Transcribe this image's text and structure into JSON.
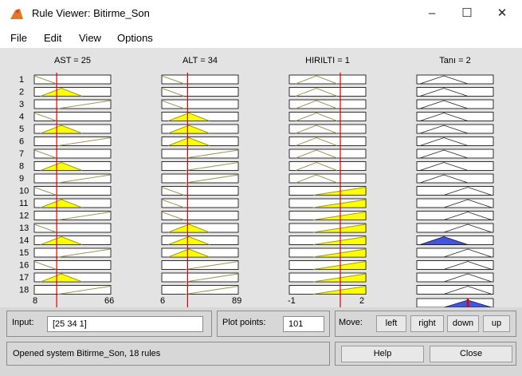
{
  "window": {
    "title": "Rule Viewer: Bitirme_Son",
    "controls": {
      "minimize": "–",
      "maximize": "☐",
      "close": "✕"
    }
  },
  "menu": [
    "File",
    "Edit",
    "View",
    "Options"
  ],
  "rule_numbers": [
    "1",
    "2",
    "3",
    "4",
    "5",
    "6",
    "7",
    "8",
    "9",
    "10",
    "11",
    "12",
    "13",
    "14",
    "15",
    "16",
    "17",
    "18"
  ],
  "columns": [
    {
      "title": "AST = 25",
      "range_min": "8",
      "range_max": "66",
      "value": 25,
      "min": 8,
      "max": 66
    },
    {
      "title": "ALT = 34",
      "range_min": "6",
      "range_max": "89",
      "value": 34,
      "min": 6,
      "max": 89
    },
    {
      "title": "HIRILTI = 1",
      "range_min": "-1",
      "range_max": "2",
      "value": 1,
      "min": -1,
      "max": 2
    },
    {
      "title": "Tanı = 2"
    }
  ],
  "input": {
    "label": "Input:",
    "value": "[25 34 1]"
  },
  "plot_points": {
    "label": "Plot points:",
    "value": "101"
  },
  "move": {
    "label": "Move:",
    "buttons": [
      "left",
      "right",
      "down",
      "up"
    ]
  },
  "status": "Opened system Bitirme_Son, 18 rules",
  "buttons": {
    "help": "Help",
    "close": "Close"
  },
  "colors": {
    "plot_background": "#e3e3e3",
    "fill_input": "#ffff00",
    "fill_output": "#4455dd",
    "index_line": "#dd0000",
    "membership_line": "#9a9a55"
  }
}
